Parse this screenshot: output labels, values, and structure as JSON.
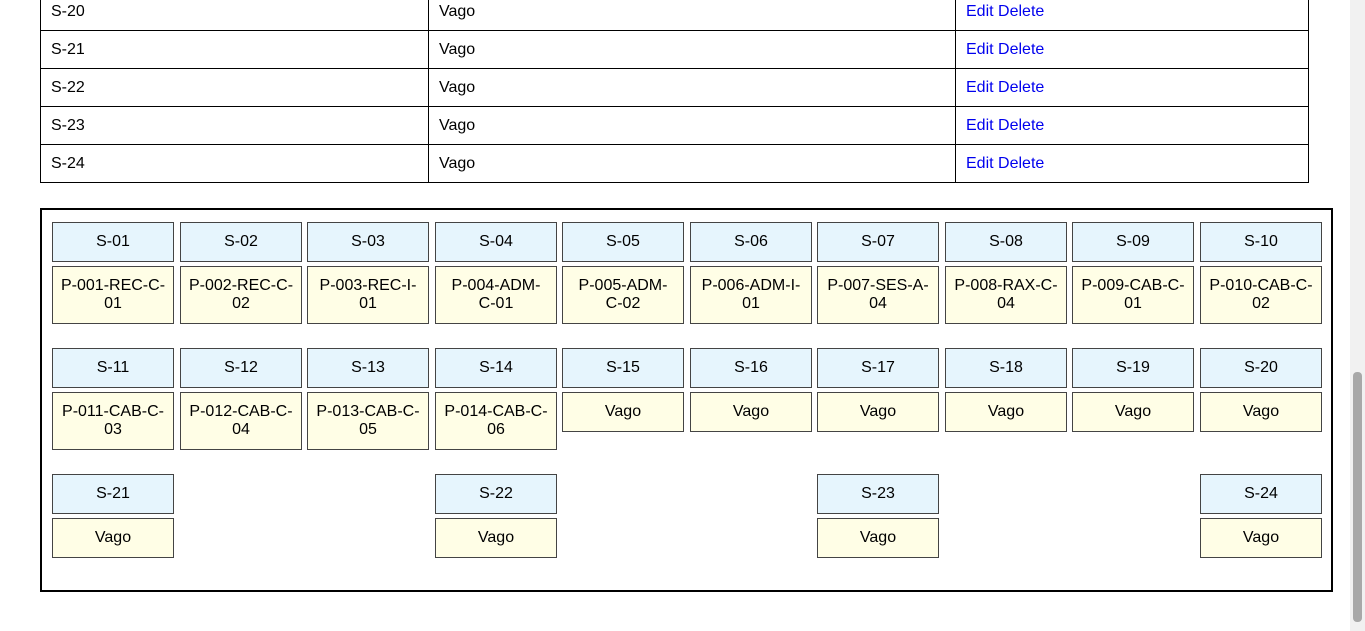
{
  "table": {
    "rows": [
      {
        "seat": "S-20",
        "status": "Vago",
        "edit": "Edit",
        "delete": "Delete"
      },
      {
        "seat": "S-21",
        "status": "Vago",
        "edit": "Edit",
        "delete": "Delete"
      },
      {
        "seat": "S-22",
        "status": "Vago",
        "edit": "Edit",
        "delete": "Delete"
      },
      {
        "seat": "S-23",
        "status": "Vago",
        "edit": "Edit",
        "delete": "Delete"
      },
      {
        "seat": "S-24",
        "status": "Vago",
        "edit": "Edit",
        "delete": "Delete"
      }
    ]
  },
  "seat_map": {
    "seats": [
      {
        "label": "S-01",
        "occupant": "P-001-REC-C-01"
      },
      {
        "label": "S-02",
        "occupant": "P-002-REC-C-02"
      },
      {
        "label": "S-03",
        "occupant": "P-003-REC-I-01"
      },
      {
        "label": "S-04",
        "occupant": "P-004-ADM-C-01"
      },
      {
        "label": "S-05",
        "occupant": "P-005-ADM-C-02"
      },
      {
        "label": "S-06",
        "occupant": "P-006-ADM-I-01"
      },
      {
        "label": "S-07",
        "occupant": "P-007-SES-A-04"
      },
      {
        "label": "S-08",
        "occupant": "P-008-RAX-C-04"
      },
      {
        "label": "S-09",
        "occupant": "P-009-CAB-C-01"
      },
      {
        "label": "S-10",
        "occupant": "P-010-CAB-C-02"
      },
      {
        "label": "S-11",
        "occupant": "P-011-CAB-C-03"
      },
      {
        "label": "S-12",
        "occupant": "P-012-CAB-C-04"
      },
      {
        "label": "S-13",
        "occupant": "P-013-CAB-C-05"
      },
      {
        "label": "S-14",
        "occupant": "P-014-CAB-C-06"
      },
      {
        "label": "S-15",
        "occupant": "Vago"
      },
      {
        "label": "S-16",
        "occupant": "Vago"
      },
      {
        "label": "S-17",
        "occupant": "Vago"
      },
      {
        "label": "S-18",
        "occupant": "Vago"
      },
      {
        "label": "S-19",
        "occupant": "Vago"
      },
      {
        "label": "S-20",
        "occupant": "Vago"
      },
      {
        "label": "S-21",
        "occupant": "Vago"
      },
      {
        "label": "S-22",
        "occupant": "Vago"
      },
      {
        "label": "S-23",
        "occupant": "Vago"
      },
      {
        "label": "S-24",
        "occupant": "Vago"
      }
    ]
  },
  "colors": {
    "seat_label_bg": "#e6f5fd",
    "occupant_bg": "#fffee6",
    "link": "#0000ee"
  }
}
